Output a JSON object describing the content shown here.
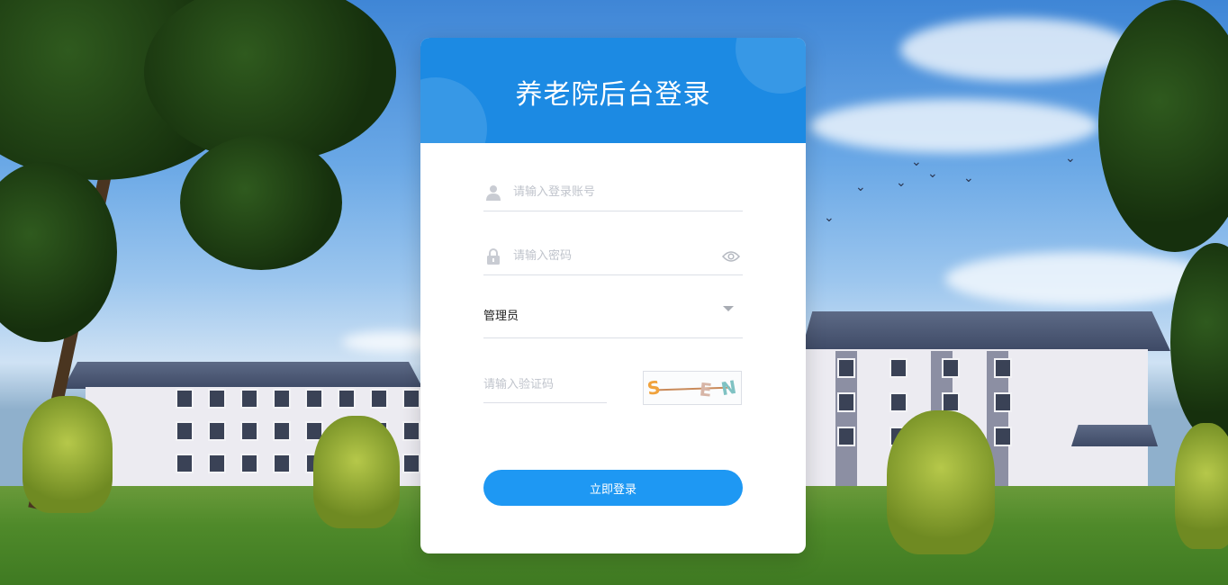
{
  "page": {
    "title": "养老院后台登录"
  },
  "form": {
    "username_placeholder": "请输入登录账号",
    "password_placeholder": "请输入密码",
    "role_selected": "管理员",
    "captcha_placeholder": "请输入验证码",
    "captcha_text": [
      "S",
      "E",
      "N"
    ],
    "login_button": "立即登录"
  },
  "icons": {
    "username": "user-icon",
    "password": "lock-icon",
    "toggle_password": "eye-icon",
    "role_dropdown": "caret-down-icon"
  },
  "colors": {
    "header": "#1c8ae3",
    "button": "#1e98f3",
    "placeholder": "#c0c4cc",
    "divider": "#dcdfe6"
  }
}
